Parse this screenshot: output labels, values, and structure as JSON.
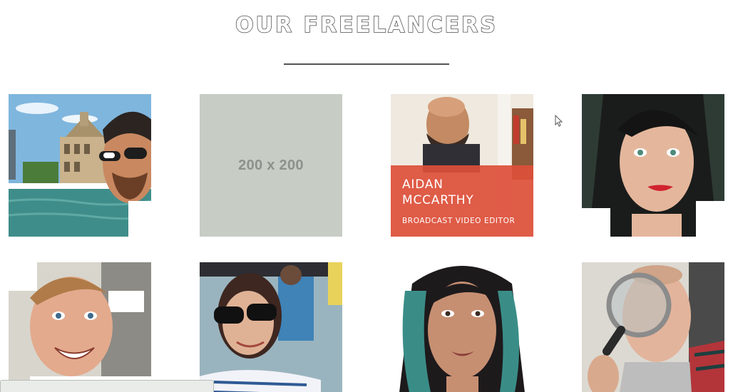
{
  "section": {
    "title": "OUR FREELANCERS"
  },
  "freelancers": [
    {
      "photo": "man-selfie-with-sunglasses-by-harbour-photo"
    },
    {
      "placeholder_text": "200 x 200"
    },
    {
      "photo": "bald-man-smiling-in-room-photo",
      "name": "AIDAN MCCARTHY",
      "role": "BROADCAST VIDEO EDITOR"
    },
    {
      "photo": "woman-with-dark-hair-and-red-lipstick-photo"
    },
    {
      "photo": "smiling-man-close-up-photo"
    },
    {
      "photo": "woman-in-sunglasses-at-event-photo"
    },
    {
      "photo": "woman-with-teal-hair-photo"
    },
    {
      "photo": "man-with-magnifying-glass-photo"
    }
  ],
  "colors": {
    "overlay": "#dd4f3a",
    "placeholder_bg": "#c7ccc5",
    "title_stroke": "#4a4a4a"
  }
}
